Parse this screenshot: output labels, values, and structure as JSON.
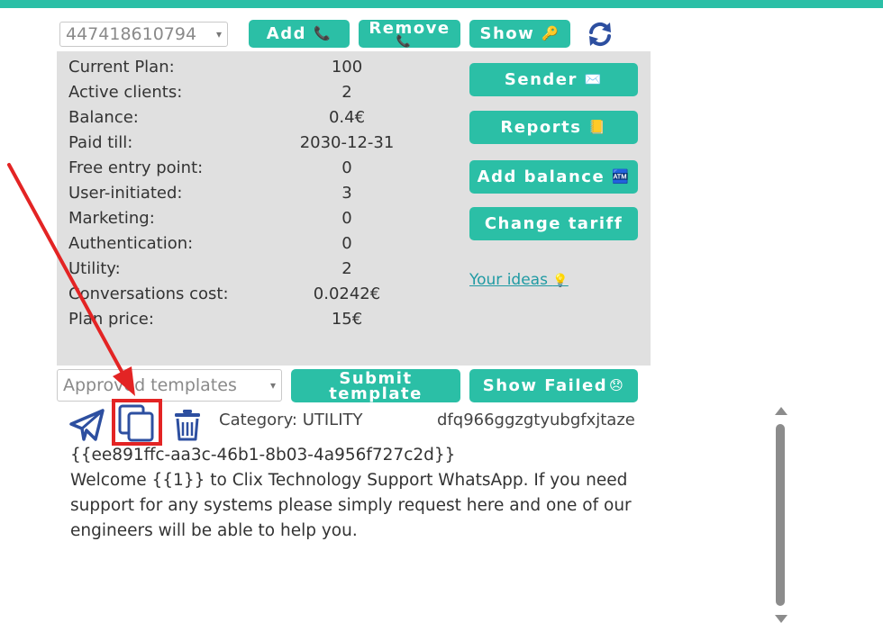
{
  "header": {
    "phone_select": {
      "value": "447418610794"
    },
    "add_label": "Add",
    "remove_label": "Remove",
    "show_label": "Show"
  },
  "icons": {
    "phone": "📞",
    "key": "🔑",
    "envelope": "✉️",
    "receipt": "📒",
    "atm": "🏧",
    "bulb": "💡",
    "disappointed": "😞"
  },
  "plan": {
    "rows": [
      {
        "label": "Current Plan:",
        "value": "100"
      },
      {
        "label": "Active clients:",
        "value": "2"
      },
      {
        "label": "Balance:",
        "value": "0.4€"
      },
      {
        "label": "Paid till:",
        "value": "2030-12-31"
      },
      {
        "label": "Free entry point:",
        "value": "0"
      },
      {
        "label": "User-initiated:",
        "value": "3"
      },
      {
        "label": "Marketing:",
        "value": "0"
      },
      {
        "label": "Authentication:",
        "value": "0"
      },
      {
        "label": "Utility:",
        "value": "2"
      },
      {
        "label": "Conversations cost:",
        "value": "0.0242€"
      },
      {
        "label": "Plan price:",
        "value": "15€"
      }
    ]
  },
  "actions": {
    "sender_label": "Sender",
    "reports_label": "Reports",
    "add_balance_label": "Add balance",
    "change_tariff_label": "Change tariff",
    "ideas_label": "Your ideas"
  },
  "templates": {
    "filter_select": {
      "value": "Approved templates"
    },
    "submit_label_line1": "Submit",
    "submit_label_line2": "template",
    "show_failed_label": "Show Failed",
    "item": {
      "category": "Category: UTILITY",
      "name": "dfq966ggzgtyubgfxjtaze",
      "id": "{{ee891ffc-aa3c-46b1-8b03-4a956f727c2d}}",
      "body": "Welcome {{1}} to Clix Technology Support WhatsApp. If you need support for any systems please simply request here and one of our engineers will be able to help you."
    }
  },
  "colors": {
    "accent": "#2bbfa6",
    "panel": "#e0e0e0",
    "annotation": "#e32424",
    "icon": "#2d4fa0"
  }
}
